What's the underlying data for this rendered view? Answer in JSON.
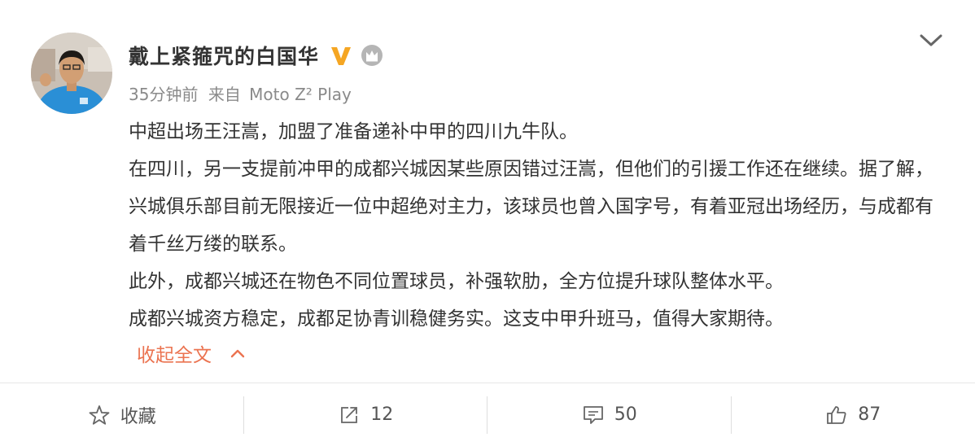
{
  "author": {
    "name": "戴上紧箍咒的白国华",
    "verified_badge_color": "#f5a623",
    "crown_badge_color": "#a6a6a6"
  },
  "meta": {
    "time": "35分钟前",
    "source_prefix": "来自",
    "source": "Moto Z² Play"
  },
  "content": {
    "paragraphs": [
      "中超出场王汪嵩，加盟了准备递补中甲的四川九牛队。",
      "在四川，另一支提前冲甲的成都兴城因某些原因错过汪嵩，但他们的引援工作还在继续。据了解，兴城俱乐部目前无限接近一位中超绝对主力，该球员也曾入国字号，有着亚冠出场经历，与成都有着千丝万缕的联系。",
      "此外，成都兴城还在物色不同位置球员，补强软肋，全方位提升球队整体水平。",
      "成都兴城资方稳定，成都足协青训稳健务实。这支中甲升班马，值得大家期待。"
    ],
    "collapse_label": "收起全文"
  },
  "actions": {
    "favorite_label": "收藏",
    "repost_count": "12",
    "comment_count": "50",
    "like_count": "87"
  },
  "colors": {
    "text": "#333333",
    "meta": "#8a8a8a",
    "accent": "#eb7350",
    "divider": "#e6e6e6"
  }
}
